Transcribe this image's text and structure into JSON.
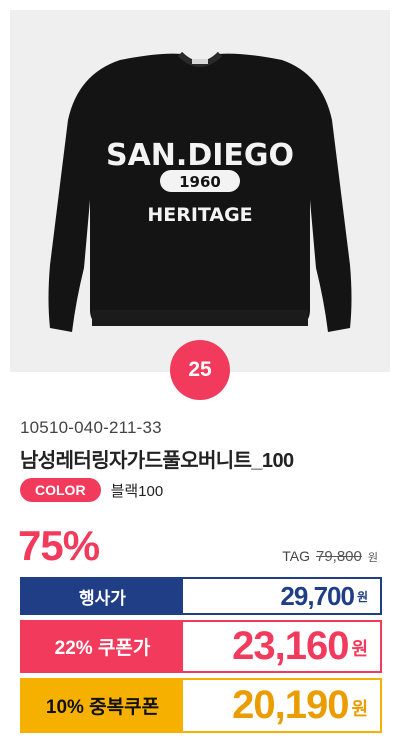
{
  "product": {
    "rank": "25",
    "sku": "10510-040-211-33",
    "name": "남성레터링자가드풀오버니트_100",
    "color_label": "COLOR",
    "color_value": "블랙100",
    "discount": "75%",
    "tag_label": "TAG",
    "tag_price": "79,800",
    "tag_unit": "원",
    "image_text": {
      "line1": "SAN.DIEGO",
      "line2": "1960",
      "line3": "HERITAGE"
    }
  },
  "prices": [
    {
      "label": "행사가",
      "value": "29,700",
      "unit": "원"
    },
    {
      "label": "22% 쿠폰가",
      "value": "23,160",
      "unit": "원"
    },
    {
      "label": "10% 중복쿠폰",
      "value": "20,190",
      "unit": "원"
    }
  ],
  "colors": {
    "accent": "#f13a5c",
    "navy": "#1f3e85",
    "gold": "#f6b100"
  }
}
